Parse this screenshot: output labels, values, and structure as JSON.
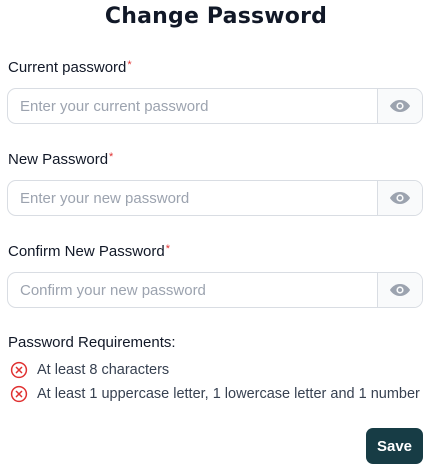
{
  "page": {
    "title": "Change Password"
  },
  "fields": {
    "current": {
      "label": "Current password",
      "required_mark": "*",
      "placeholder": "Enter your current password",
      "value": "",
      "toggle_icon": "eye-icon"
    },
    "new": {
      "label": "New Password",
      "required_mark": "*",
      "placeholder": "Enter your new password",
      "value": "",
      "toggle_icon": "eye-icon"
    },
    "confirm": {
      "label": "Confirm New Password",
      "required_mark": "*",
      "placeholder": "Confirm your new password",
      "value": "",
      "toggle_icon": "eye-icon"
    }
  },
  "requirements": {
    "title": "Password Requirements:",
    "items": [
      {
        "text": "At least 8 characters",
        "status": "unmet",
        "icon": "x-circle-icon"
      },
      {
        "text": "At least 1 uppercase letter, 1 lowercase letter and 1 number",
        "status": "unmet",
        "icon": "x-circle-icon"
      }
    ]
  },
  "actions": {
    "save_label": "Save"
  },
  "colors": {
    "required_star": "#e03131",
    "error_icon": "#e03131",
    "save_button": "#173c45",
    "input_border": "#d9dde3",
    "eye_icon": "#9ca3af"
  }
}
